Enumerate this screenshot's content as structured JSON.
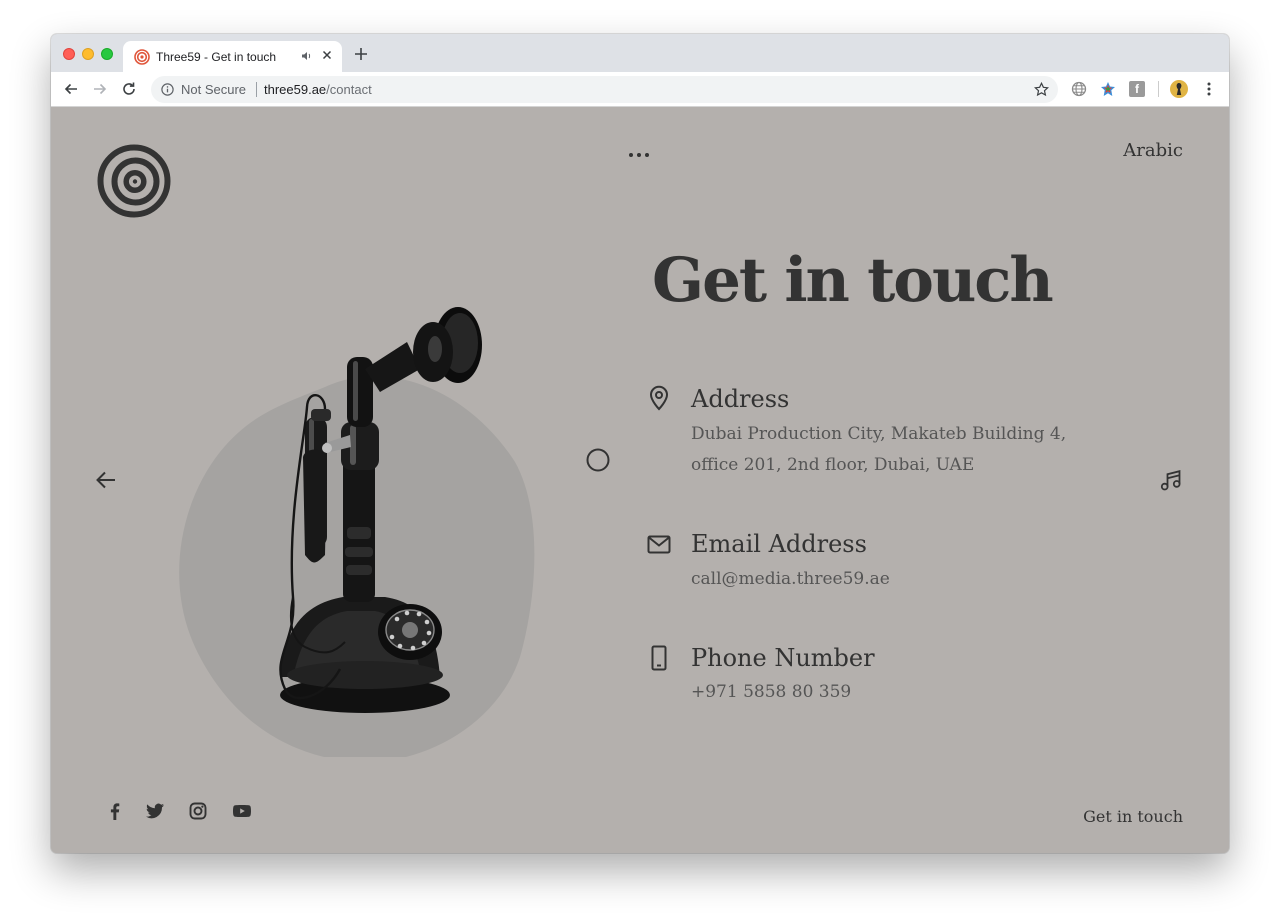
{
  "browser": {
    "tab": {
      "title": "Three59 - Get in touch"
    },
    "address_bar": {
      "security_label": "Not Secure",
      "url_host": "three59.ae",
      "url_path": "/contact"
    }
  },
  "header": {
    "language_link": "Arabic"
  },
  "main": {
    "title": "Get in touch",
    "sections": [
      {
        "heading": "Address",
        "lines": [
          "Dubai Production City, Makateb Building 4,",
          "office 201, 2nd floor, Dubai, UAE"
        ],
        "icon": "location-pin-icon"
      },
      {
        "heading": "Email Address",
        "lines": [
          "call@media.three59.ae"
        ],
        "icon": "envelope-icon"
      },
      {
        "heading": "Phone Number",
        "lines": [
          "+971 5858 80 359"
        ],
        "icon": "mobile-phone-icon"
      }
    ]
  },
  "footer": {
    "social": [
      "facebook-icon",
      "twitter-icon",
      "instagram-icon",
      "youtube-icon"
    ],
    "link": "Get in touch"
  },
  "colors": {
    "page_background": "#b4b0ad",
    "blob": "#a5a3a1",
    "text_dark": "#333333",
    "text_muted": "#555555"
  }
}
